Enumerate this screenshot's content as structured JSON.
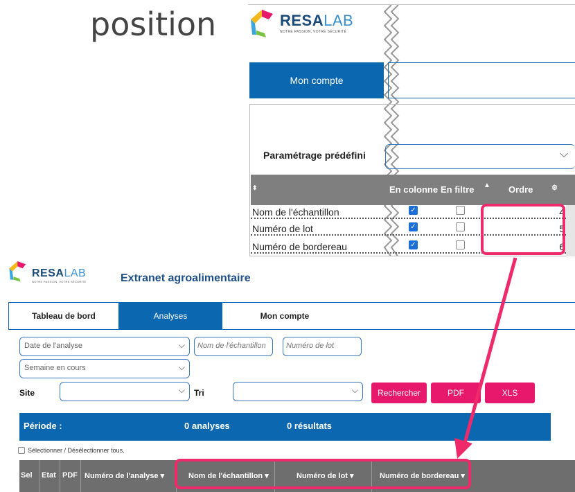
{
  "heading": "position",
  "logo": {
    "part1": "RESA",
    "part2": "LAB",
    "tagline": "NOTRE PASSION, VOTRE SÉCURITÉ"
  },
  "top_panel": {
    "tab_label": "Mon compte",
    "param_label": "Paramétrage prédéfini",
    "grid_headers": {
      "sort": "⬍",
      "en_colonne": "En colonne",
      "en_filtre": "En filtre",
      "ordre": "Ordre"
    },
    "rows": [
      {
        "name": "Nom de l'échantillon",
        "en_colonne": true,
        "en_filtre": false,
        "ordre": "4"
      },
      {
        "name": "Numéro de lot",
        "en_colonne": true,
        "en_filtre": false,
        "ordre": "5"
      },
      {
        "name": "Numéro de bordereau",
        "en_colonne": true,
        "en_filtre": false,
        "ordre": "6"
      }
    ]
  },
  "bottom_panel": {
    "app_title": "Extranet agroalimentaire",
    "tabs": [
      "Tableau de bord",
      "Analyses",
      "Mon compte"
    ],
    "active_tab": "Analyses",
    "filters": {
      "date_select": "Date de l'analyse",
      "nom_placeholder": "Nom de l'échantillon",
      "lot_placeholder": "Numéro de lot",
      "week_select": "Semaine en cours",
      "site_label": "Site",
      "tri_label": "Tri"
    },
    "buttons": {
      "search": "Rechercher",
      "pdf": "PDF",
      "xls": "XLS"
    },
    "summary": {
      "periode": "Période :",
      "analyses": "0 analyses",
      "resultats": "0 résultats"
    },
    "select_all": "Sélectionner / Désélectionner tous.",
    "columns": [
      "Sel",
      "Etat",
      "PDF",
      "Numéro de l'analyse",
      "Nom de l'échantillon",
      "Numéro de lot",
      "Numéro de bordereau"
    ]
  },
  "colors": {
    "primary_blue": "#0a67b0",
    "highlight": "#ee2a6b",
    "button": "#e8196c"
  }
}
